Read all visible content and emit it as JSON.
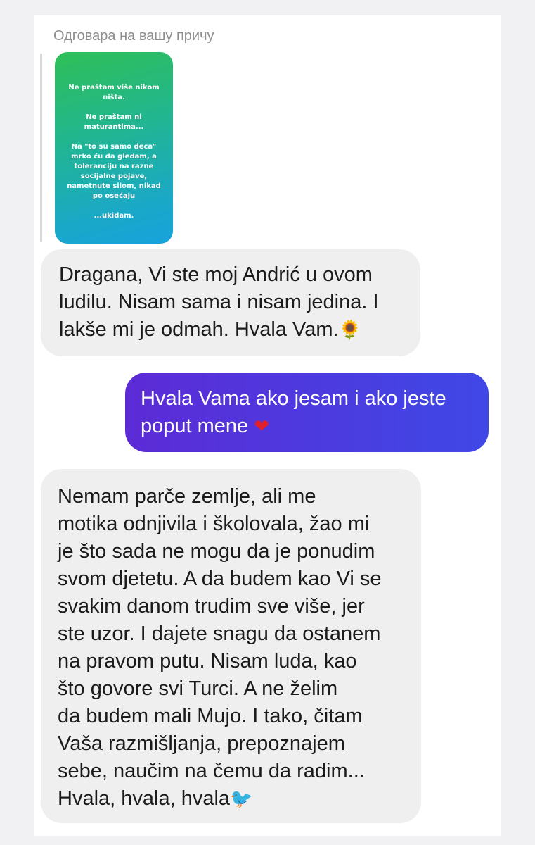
{
  "reply_label": "Одговара на вашу причу",
  "story": {
    "lines": [
      "Ne praštam više nikom",
      "ništa.",
      "",
      "Ne praštam ni",
      "maturantima...",
      "",
      "Na \"to su samo deca\"",
      "mrko ću da gledam, a",
      "toleranciju na razne",
      "socijalne pojave,",
      "nametnute silom, nikad",
      "po osećaju",
      "",
      "...ukidam."
    ],
    "gradient_colors": [
      "#2fbf57",
      "#17a2dc"
    ]
  },
  "messages": [
    {
      "direction": "incoming",
      "lines": [
        "Dragana, Vi ste moj Andrić u ovom",
        "ludilu. Nisam sama i nisam jedina. I",
        "lakše mi je odmah. Hvala Vam."
      ],
      "emoji": "🌻",
      "emoji_name": "sunflower-icon"
    },
    {
      "direction": "outgoing",
      "lines": [
        "Hvala Vama ako jesam i ako jeste",
        "poput mene"
      ],
      "emoji": "❤",
      "emoji_name": "heart-icon"
    },
    {
      "direction": "incoming",
      "lines": [
        "Nemam parče zemlje, ali me",
        "motika odnjivila i školovala, žao mi",
        "je što sada ne mogu da je ponudim",
        "svom djetetu. A da budem kao Vi se",
        "svakim danom trudim sve više, jer",
        "ste uzor. I dajete snagu da ostanem",
        "na pravom putu. Nisam luda, kao",
        "što govore svi Turci. A ne želim",
        "da budem mali Mujo. I tako, čitam",
        "Vaša razmišljanja, prepoznajem",
        "sebe, naučim na čemu da radim...",
        "Hvala, hvala, hvala"
      ],
      "emoji": "🐦",
      "emoji_name": "bird-icon"
    }
  ],
  "colors": {
    "incoming_bubble": "#efefef",
    "outgoing_gradient": [
      "#5c2bd6",
      "#3f48e6"
    ]
  }
}
